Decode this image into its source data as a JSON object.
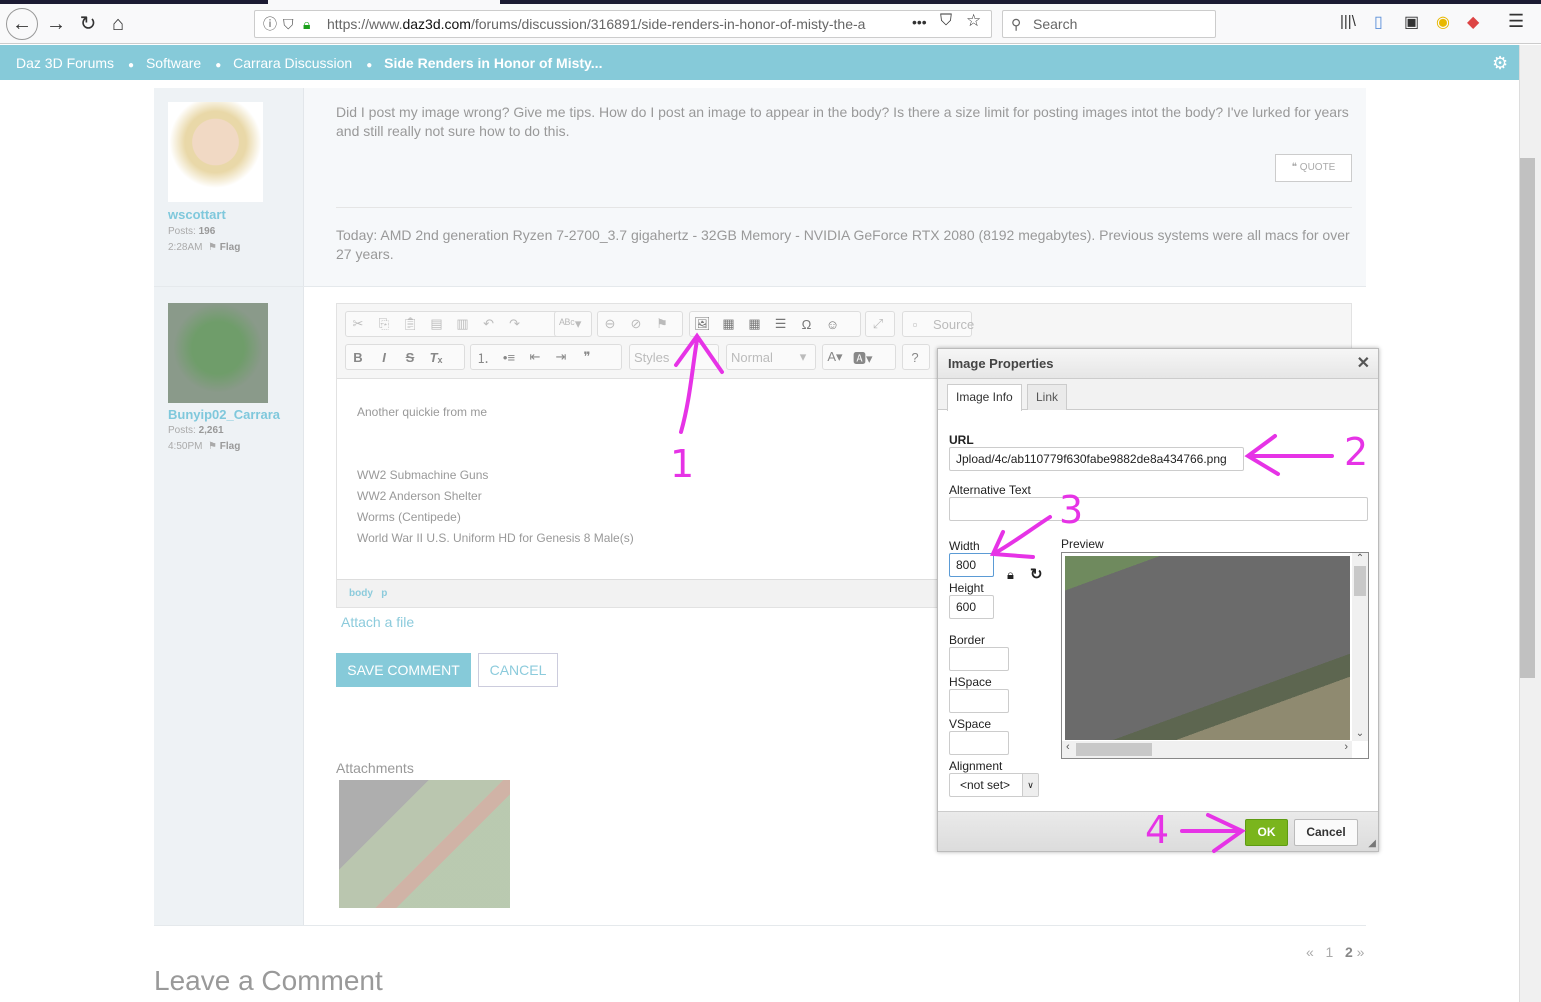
{
  "browser": {
    "url_prefix": "https://www.",
    "url_domain": "daz3d.com",
    "url_path": "/forums/discussion/316891/side-renders-in-honor-of-misty-the-a",
    "search_placeholder": "Search"
  },
  "breadcrumb": [
    "Daz 3D Forums",
    "Software",
    "Carrara Discussion",
    "Side Renders in Honor of Misty..."
  ],
  "posts": [
    {
      "user": "wscottart",
      "posts_label": "Posts:",
      "posts": "196",
      "time": "2:28AM",
      "flag": "Flag",
      "body": "Did I post my image wrong? Give me tips. How do I post an image to appear in the body? Is there a size limit for posting images intot the body? I've lurked for years and still really not sure how to do this.",
      "quote": "QUOTE",
      "signature": "Today: AMD 2nd generation Ryzen 7-2700_3.7 gigahertz - 32GB Memory - NVIDIA GeForce RTX 2080 (8192 megabytes).  Previous systems were all macs for over 27 years."
    },
    {
      "user": "Bunyip02_Carrara",
      "posts_label": "Posts:",
      "posts": "2,261",
      "time": "4:50PM",
      "flag": "Flag"
    }
  ],
  "editor": {
    "source": "Source",
    "styles": "Styles",
    "format": "Normal",
    "lines": [
      "Another quickie from me",
      "",
      "",
      "WW2 Submachine Guns",
      "WW2 Anderson Shelter",
      "Worms (Centipede)",
      "World War II U.S. Uniform HD for Genesis 8 Male(s)"
    ],
    "path": [
      "body",
      "p"
    ]
  },
  "attach_link": "Attach a file",
  "save": "SAVE COMMENT",
  "cancel": "CANCEL",
  "attachments_label": "Attachments",
  "pager": {
    "prev": "«",
    "pages": [
      "1",
      "2"
    ],
    "next": "»"
  },
  "leave_comment": "Leave a Comment",
  "dialog": {
    "title": "Image Properties",
    "tabs": [
      "Image Info",
      "Link"
    ],
    "url_label": "URL",
    "url": "Jpload/4c/ab110779f630fabe9882de8a434766.png",
    "alt_label": "Alternative Text",
    "alt": "",
    "width_label": "Width",
    "width": "800",
    "height_label": "Height",
    "height": "600",
    "border_label": "Border",
    "hspace_label": "HSpace",
    "vspace_label": "VSpace",
    "alignment_label": "Alignment",
    "alignment": "<not set>",
    "preview_label": "Preview",
    "ok": "OK",
    "cancel": "Cancel"
  },
  "annotations": {
    "color": "#e633e6",
    "steps": [
      "1",
      "2",
      "3",
      "4"
    ]
  },
  "colors": {
    "accent": "#86cad9",
    "ok_green": "#7ab51d"
  }
}
